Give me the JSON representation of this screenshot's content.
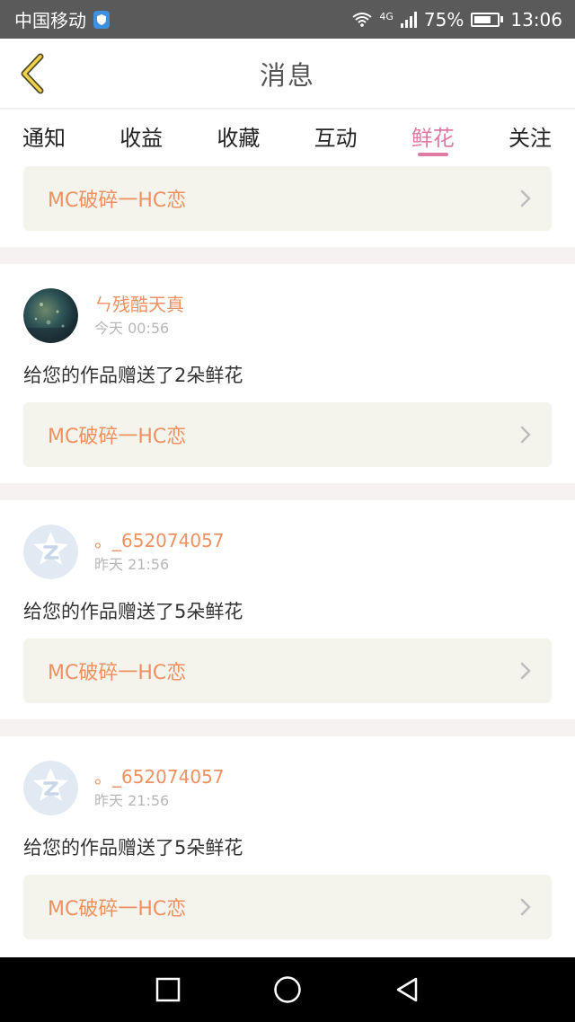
{
  "status_bar": {
    "carrier": "中国移动",
    "network": "4G",
    "battery": "75%",
    "battery_level": 0.75,
    "time": "13:06"
  },
  "header": {
    "title": "消息",
    "back_icon": "chevron-left-icon"
  },
  "tabs": [
    {
      "label": "通知",
      "active": false
    },
    {
      "label": "收益",
      "active": false
    },
    {
      "label": "收藏",
      "active": false
    },
    {
      "label": "互动",
      "active": false
    },
    {
      "label": "鲜花",
      "active": true
    },
    {
      "label": "关注",
      "active": false
    }
  ],
  "colors": {
    "accent": "#e07aa4",
    "highlight": "#ee9161",
    "link_bg": "#f4f3ec"
  },
  "top_card": {
    "work_title": "MC破碎一HC恋"
  },
  "messages": [
    {
      "user": "ㄣ残酷天真",
      "time": "今天 00:56",
      "text": "给您的作品赠送了2朵鲜花",
      "work_title": "MC破碎一HC恋",
      "avatar": "photo-avatar"
    },
    {
      "user": "。_652074057",
      "time": "昨天 21:56",
      "text": "给您的作品赠送了5朵鲜花",
      "work_title": "MC破碎一HC恋",
      "avatar": "default-qq-avatar"
    },
    {
      "user": "。_652074057",
      "time": "昨天 21:56",
      "text": "给您的作品赠送了5朵鲜花",
      "work_title": "MC破碎一HC恋",
      "avatar": "default-qq-avatar"
    }
  ],
  "nav": [
    "square-icon",
    "circle-icon",
    "triangle-back-icon"
  ]
}
